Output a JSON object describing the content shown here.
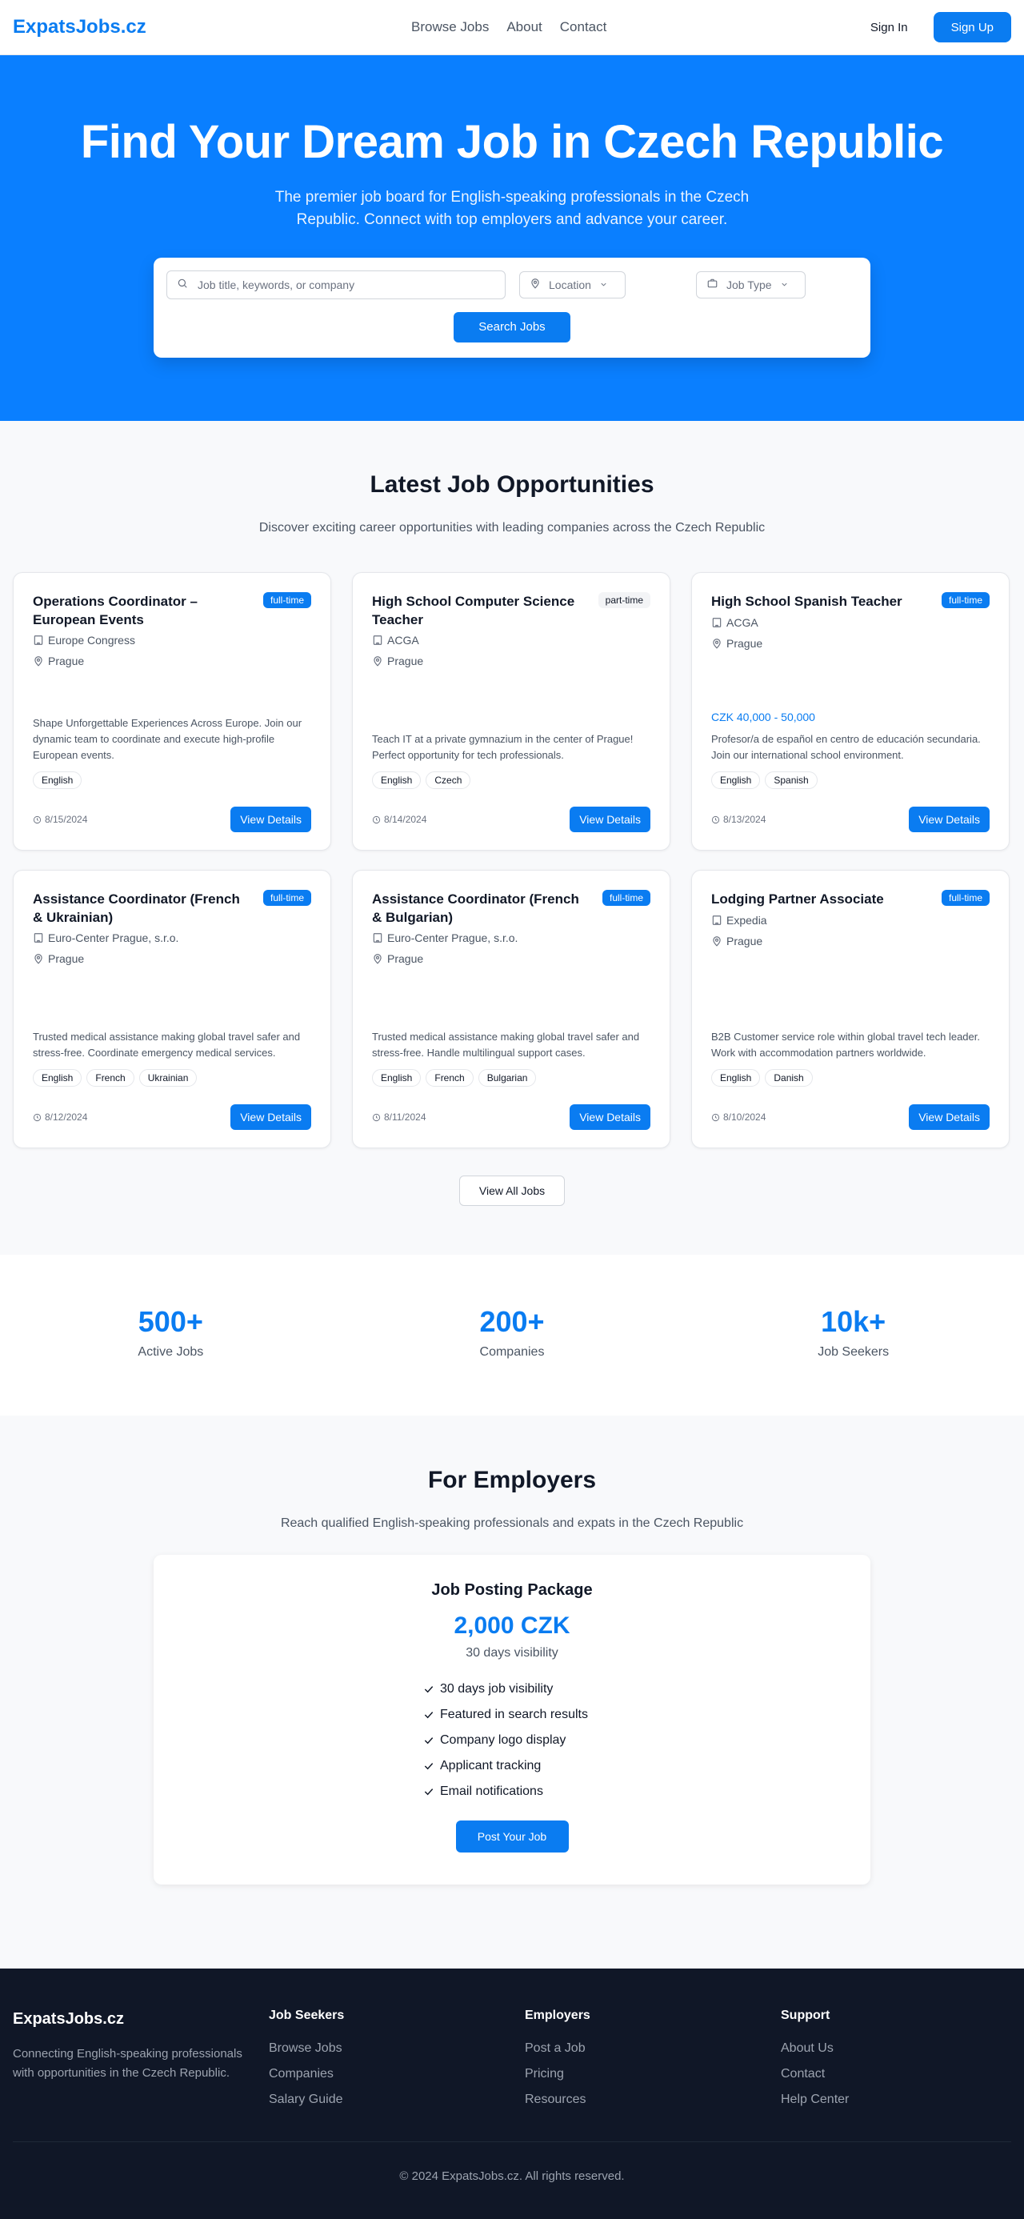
{
  "nav": {
    "logo": "ExpatsJobs.cz",
    "links": [
      "Browse Jobs",
      "About",
      "Contact"
    ],
    "sign_in": "Sign In",
    "sign_up": "Sign Up"
  },
  "hero": {
    "title": "Find Your Dream Job in Czech Republic",
    "subtitle": "The premier job board for English-speaking professionals in the Czech Republic. Connect with top employers and advance your career.",
    "search": {
      "placeholder": "Job title, keywords, or company",
      "location": "Location",
      "job_type": "Job Type",
      "button": "Search Jobs"
    }
  },
  "jobs": {
    "title": "Latest Job Opportunities",
    "subtitle": "Discover exciting career opportunities with leading companies across the Czech Republic",
    "view_label": "View Details",
    "view_all": "View All Jobs",
    "items": [
      {
        "title": "Operations Coordinator – European Events",
        "type": "full-time",
        "company": "Europe Congress",
        "location": "Prague",
        "salary": "",
        "description": "Shape Unforgettable Experiences Across Europe. Join our dynamic team to coordinate and execute high-profile European events.",
        "tags": [
          "English"
        ],
        "date": "8/15/2024"
      },
      {
        "title": "High School Computer Science Teacher",
        "type": "part-time",
        "company": "ACGA",
        "location": "Prague",
        "salary": "",
        "description": "Teach IT at a private gymnazium in the center of Prague! Perfect opportunity for tech professionals.",
        "tags": [
          "English",
          "Czech"
        ],
        "date": "8/14/2024"
      },
      {
        "title": "High School Spanish Teacher",
        "type": "full-time",
        "company": "ACGA",
        "location": "Prague",
        "salary": "CZK 40,000 - 50,000",
        "description": "Profesor/a de español en centro de educación secundaria. Join our international school environment.",
        "tags": [
          "English",
          "Spanish"
        ],
        "date": "8/13/2024"
      },
      {
        "title": "Assistance Coordinator (French & Ukrainian)",
        "type": "full-time",
        "company": "Euro-Center Prague, s.r.o.",
        "location": "Prague",
        "salary": "",
        "description": "Trusted medical assistance making global travel safer and stress-free. Coordinate emergency medical services.",
        "tags": [
          "English",
          "French",
          "Ukrainian"
        ],
        "date": "8/12/2024"
      },
      {
        "title": "Assistance Coordinator (French & Bulgarian)",
        "type": "full-time",
        "company": "Euro-Center Prague, s.r.o.",
        "location": "Prague",
        "salary": "",
        "description": "Trusted medical assistance making global travel safer and stress-free. Handle multilingual support cases.",
        "tags": [
          "English",
          "French",
          "Bulgarian"
        ],
        "date": "8/11/2024"
      },
      {
        "title": "Lodging Partner Associate",
        "type": "full-time",
        "company": "Expedia",
        "location": "Prague",
        "salary": "",
        "description": "B2B Customer service role within global travel tech leader. Work with accommodation partners worldwide.",
        "tags": [
          "English",
          "Danish"
        ],
        "date": "8/10/2024"
      }
    ]
  },
  "stats": [
    {
      "value": "500+",
      "label": "Active Jobs"
    },
    {
      "value": "200+",
      "label": "Companies"
    },
    {
      "value": "10k+",
      "label": "Job Seekers"
    }
  ],
  "employers": {
    "title": "For Employers",
    "subtitle": "Reach qualified English-speaking professionals and expats in the Czech Republic",
    "package": {
      "title": "Job Posting Package",
      "price": "2,000 CZK",
      "duration": "30 days visibility",
      "features": [
        "30 days job visibility",
        "Featured in search results",
        "Company logo display",
        "Applicant tracking",
        "Email notifications"
      ],
      "button": "Post Your Job"
    }
  },
  "footer": {
    "brand": "ExpatsJobs.cz",
    "about": "Connecting English-speaking professionals with opportunities in the Czech Republic.",
    "columns": [
      {
        "title": "Job Seekers",
        "links": [
          "Browse Jobs",
          "Companies",
          "Salary Guide"
        ]
      },
      {
        "title": "Employers",
        "links": [
          "Post a Job",
          "Pricing",
          "Resources"
        ]
      },
      {
        "title": "Support",
        "links": [
          "About Us",
          "Contact",
          "Help Center"
        ]
      }
    ],
    "copyright": "© 2024 ExpatsJobs.cz. All rights reserved."
  },
  "colors": {
    "brand": "#0a7cf1",
    "hero_bg": "#0a7fff",
    "footer_bg": "#101727"
  },
  "icons": [
    "search-icon",
    "map-pin-icon",
    "briefcase-icon",
    "chevron-down-icon",
    "building-icon",
    "clock-icon",
    "check-icon"
  ]
}
